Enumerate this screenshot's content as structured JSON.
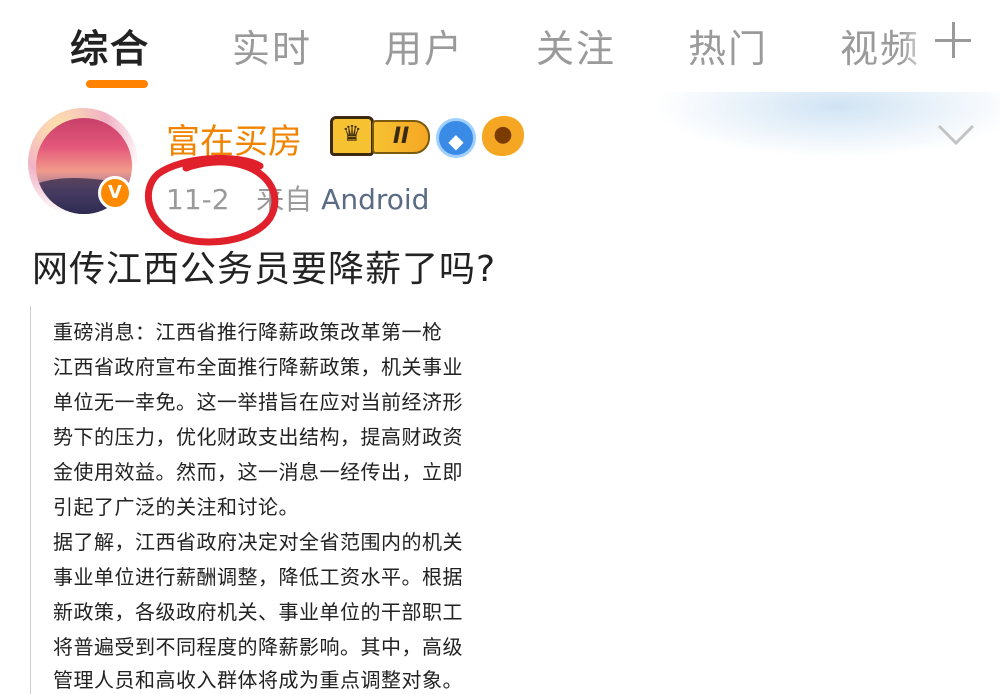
{
  "tabs": [
    {
      "label": "综合",
      "active": true
    },
    {
      "label": "实时",
      "active": false
    },
    {
      "label": "用户",
      "active": false
    },
    {
      "label": "关注",
      "active": false
    },
    {
      "label": "热门",
      "active": false
    },
    {
      "label": "视频",
      "active": false
    }
  ],
  "add_tab_icon": "plus-icon",
  "accent_color": "#ff8200",
  "post": {
    "username": "富在买房",
    "vip_crown": "♛",
    "vip_level": "II",
    "avatar_badge": "V",
    "date": "11-2",
    "source_prefix": "来自",
    "source": "Android",
    "title": "网传江西公务员要降薪了吗?",
    "quote_lines": [
      "重磅消息：江西省推行降薪政策改革第一枪",
      "江西省政府宣布全面推行降薪政策，机关事业",
      "单位无一幸免。这一举措旨在应对当前经济形",
      "势下的压力，优化财政支出结构，提高财政资",
      "金使用效益。然而，这一消息一经传出，立即",
      "引起了广泛的关注和讨论。",
      "据了解，江西省政府决定对全省范围内的机关",
      "事业单位进行薪酬调整，降低工资水平。根据",
      "新政策，各级政府机关、事业单位的干部职工",
      "将普遍受到不同程度的降薪影响。其中，高级",
      "管理人员和高收入群体将成为重点调整对象。"
    ]
  }
}
